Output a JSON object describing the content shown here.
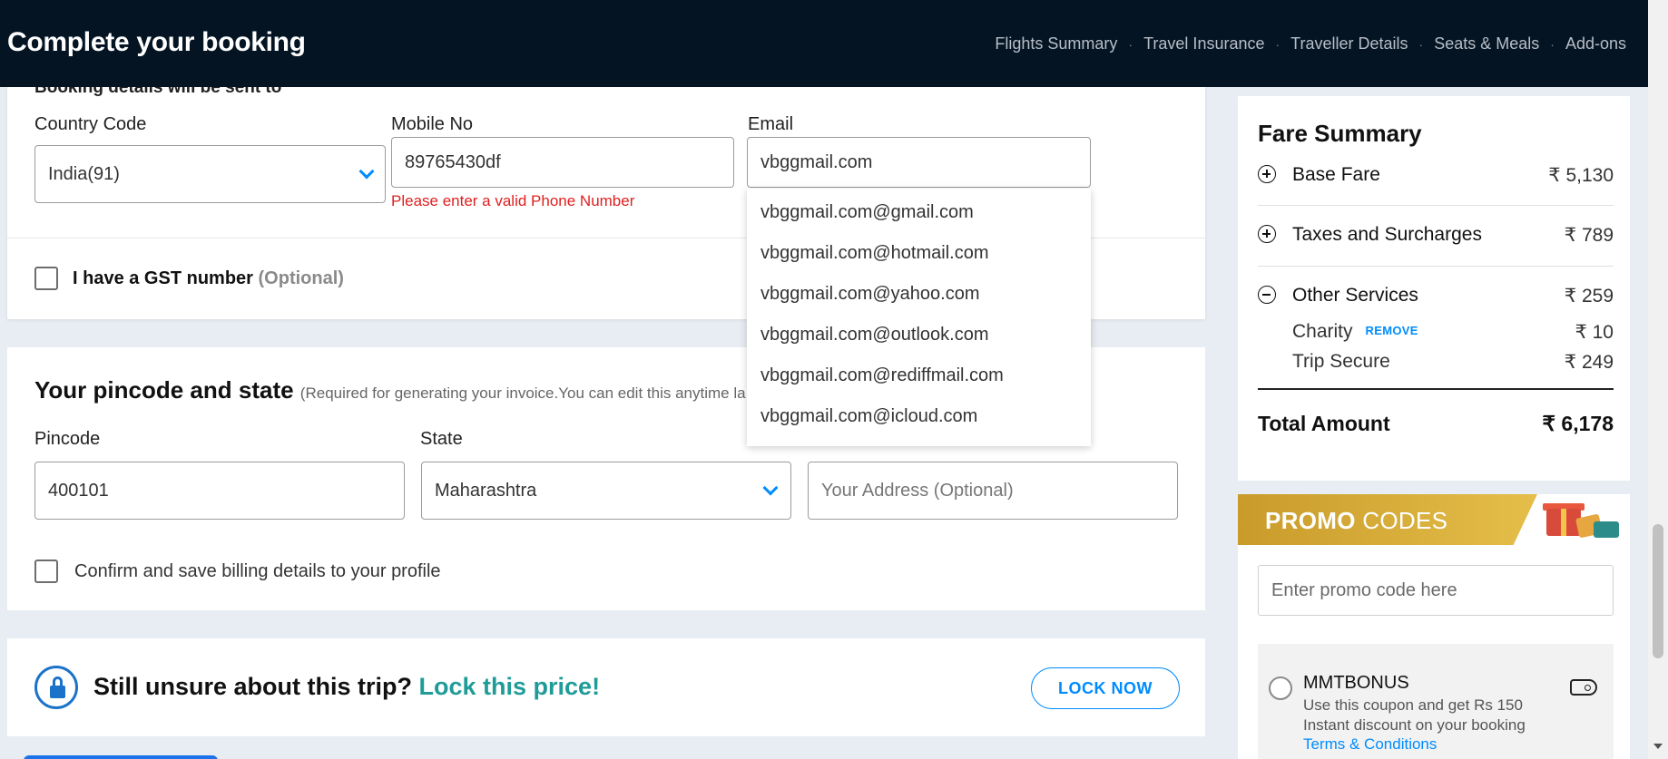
{
  "header": {
    "title": "Complete your booking",
    "steps": [
      "Flights Summary",
      "Travel Insurance",
      "Traveller Details",
      "Seats & Meals",
      "Add-ons"
    ],
    "separator": "·"
  },
  "contact": {
    "section_text": "Booking details will be sent to",
    "country_code_label": "Country Code",
    "country_code_value": "India(91)",
    "mobile_label": "Mobile No",
    "mobile_value": "89765430df",
    "mobile_error": "Please enter a valid Phone Number",
    "email_label": "Email",
    "email_value": "vbggmail.com",
    "email_suggestions": [
      "vbggmail.com@gmail.com",
      "vbggmail.com@hotmail.com",
      "vbggmail.com@yahoo.com",
      "vbggmail.com@outlook.com",
      "vbggmail.com@rediffmail.com",
      "vbggmail.com@icloud.com"
    ],
    "gst_label": "I have a GST number",
    "gst_optional": "(Optional)"
  },
  "billing": {
    "title": "Your pincode and state",
    "subtitle": "(Required for generating your invoice.You can edit this anytime la",
    "pincode_label": "Pincode",
    "pincode_value": "400101",
    "state_label": "State",
    "state_value": "Maharashtra",
    "address_placeholder": "Your Address (Optional)",
    "save_label": "Confirm and save billing details to your profile"
  },
  "lock": {
    "text": "Still unsure about this trip?",
    "highlight": "Lock this price!",
    "button": "LOCK NOW"
  },
  "fare": {
    "title": "Fare Summary",
    "base_fare_label": "Base Fare",
    "base_fare_value": "₹ 5,130",
    "taxes_label": "Taxes and Surcharges",
    "taxes_value": "₹ 789",
    "other_label": "Other Services",
    "other_value": "₹ 259",
    "charity_label": "Charity",
    "charity_remove": "REMOVE",
    "charity_value": "₹ 10",
    "trip_secure_label": "Trip Secure",
    "trip_secure_value": "₹ 249",
    "total_label": "Total Amount",
    "total_value": "₹ 6,178"
  },
  "promo": {
    "title_bold": "PROMO",
    "title_rest": "CODES",
    "input_placeholder": "Enter promo code here",
    "coupon_code": "MMTBONUS",
    "coupon_desc": "Use this coupon and get Rs 150 Instant discount on your booking",
    "coupon_tnc": "Terms & Conditions"
  },
  "colors": {
    "header_bg": "#041422",
    "accent_blue": "#008cff",
    "error_red": "#e02020",
    "lock_highlight": "#1f9c98",
    "promo_gold": "#d4a93a"
  }
}
